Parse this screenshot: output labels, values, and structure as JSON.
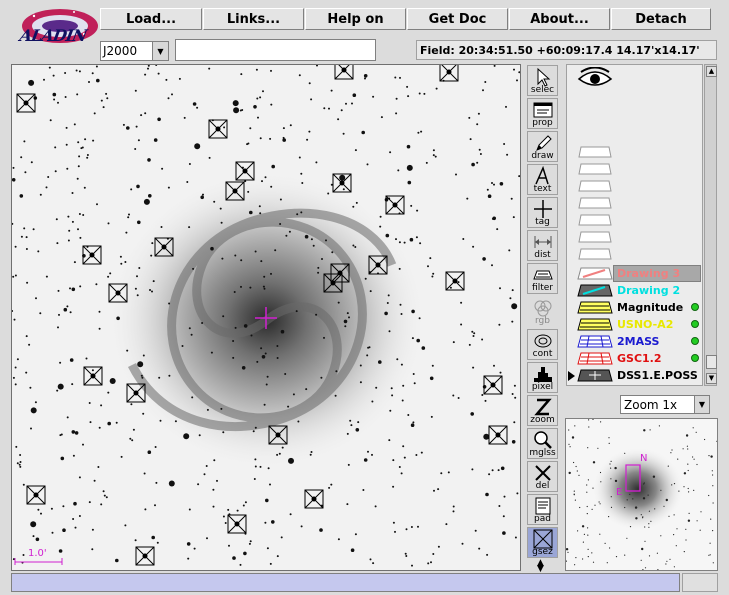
{
  "logo_text": "ALADIN",
  "toolbar": {
    "load": "Load...",
    "links": "Links...",
    "help": "Help on",
    "getdoc": "Get Doc",
    "about": "About...",
    "detach": "Detach"
  },
  "frame": {
    "value": "J2000"
  },
  "command": {
    "value": ""
  },
  "field_info": "Field: 20:34:51.50 +60:09:17.4   14.17'x14.17'",
  "scale_label": "1.0'",
  "tools": [
    {
      "id": "select",
      "label": "selec"
    },
    {
      "id": "prop",
      "label": "prop"
    },
    {
      "id": "draw",
      "label": "draw"
    },
    {
      "id": "text",
      "label": "text"
    },
    {
      "id": "tag",
      "label": "tag"
    },
    {
      "id": "dist",
      "label": "dist"
    },
    {
      "id": "filter",
      "label": "filter"
    },
    {
      "id": "rgb",
      "label": "rgb"
    },
    {
      "id": "cont",
      "label": "cont"
    },
    {
      "id": "pixel",
      "label": "pixel"
    },
    {
      "id": "zoom",
      "label": "zoom"
    },
    {
      "id": "mglss",
      "label": "mglss"
    },
    {
      "id": "del",
      "label": "del"
    },
    {
      "id": "pad",
      "label": "pad"
    },
    {
      "id": "gsez",
      "label": "gsez"
    }
  ],
  "planes": [
    {
      "name": "Drawing 3",
      "color": "#f08080"
    },
    {
      "name": "Drawing 2",
      "color": "#00e0e0"
    },
    {
      "name": "Magnitude",
      "color": "#000000"
    },
    {
      "name": "USNO-A2",
      "color": "#e8e800"
    },
    {
      "name": "2MASS",
      "color": "#1a1ad0"
    },
    {
      "name": "GSC1.2",
      "color": "#e01010"
    },
    {
      "name": "DSS1.E.POSS",
      "color": "#000000"
    }
  ],
  "zoom": {
    "value": "Zoom 1x"
  },
  "compass": {
    "north": "N",
    "east": "E"
  },
  "colors": {
    "marker": "#000000",
    "center_cross": "#d020d0",
    "status_bar": "#c5c8ee"
  }
}
